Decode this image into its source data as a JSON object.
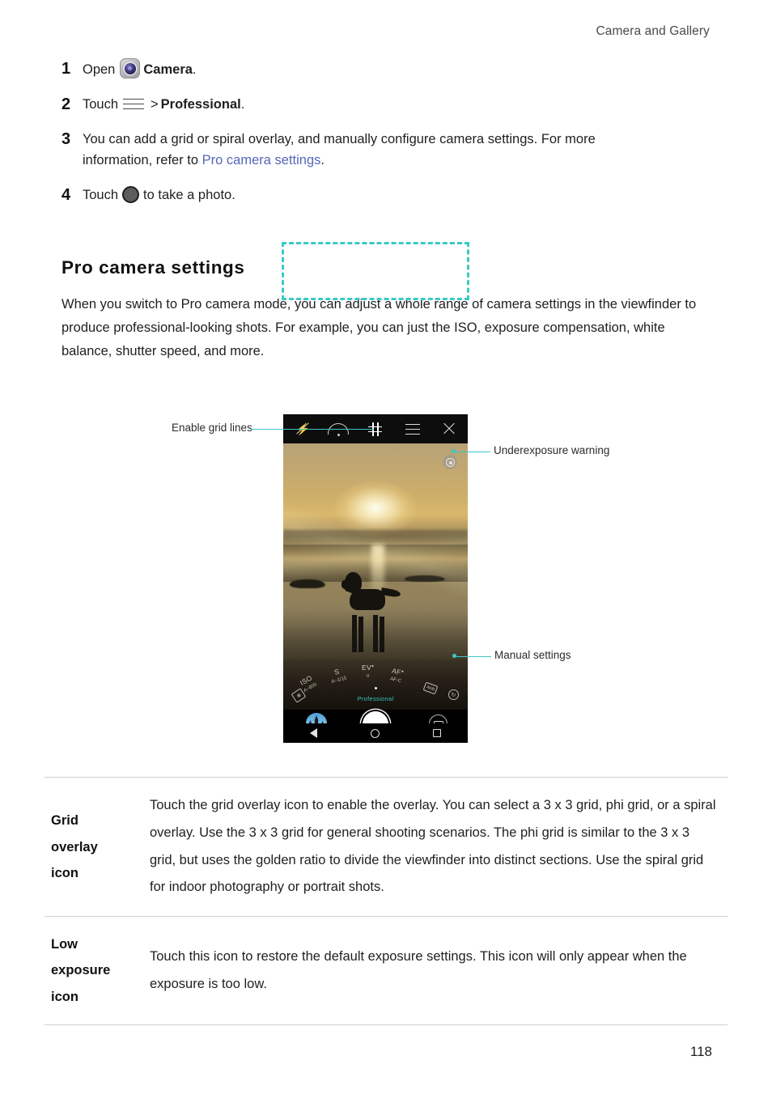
{
  "header": {
    "running_head": "Camera and Gallery"
  },
  "steps": [
    {
      "num": "1",
      "pre": "Open",
      "icon": "camera-app-icon",
      "bold": "Camera",
      "post": "."
    },
    {
      "num": "2",
      "pre": "Touch",
      "icon": "hamburger-menu-icon",
      "sep": ">",
      "bold": "Professional",
      "post": "."
    },
    {
      "num": "3",
      "line1": "You can add a grid or spiral overlay, and manually configure camera settings. For more",
      "line2_pre": "information, refer to ",
      "link": "Pro camera settings",
      "line2_post": "."
    },
    {
      "num": "4",
      "pre": "Touch",
      "icon": "shutter-button-icon",
      "post": "to take a photo."
    }
  ],
  "section": {
    "heading": "Pro camera settings",
    "paragraph": "When you switch to Pro camera mode, you can adjust a whole range of camera settings in the viewfinder to produce professional-looking shots. For example, you can just the ISO, exposure compensation, white balance, shutter speed, and more."
  },
  "figure": {
    "callouts": [
      {
        "id": "enable-grid-lines",
        "label": "Enable grid lines"
      },
      {
        "id": "underexposure-warning",
        "label": "Underexposure warning"
      },
      {
        "id": "manual-settings",
        "label": "Manual settings"
      }
    ],
    "accent_color": "#3cc9c4",
    "phone_screen": {
      "top_bar_icons": [
        "flash-off-icon",
        "arc-icon",
        "grid-overlay-icon",
        "hamburger-menu-icon",
        "close-icon"
      ],
      "manual_dial": {
        "iso_label": "ISO",
        "iso_value": "A~800",
        "shutter_label": "S",
        "shutter_value": "A~1/15",
        "ev_label": "EV",
        "ev_value": "0",
        "af_label": "AF",
        "af_value": "AF-C",
        "wb_left_icon": "metering-icon",
        "wb_right_label": "AWB",
        "meter_icon": "timer-icon",
        "mode_label": "Professional",
        "mode_color": "#36c6c0"
      },
      "bottom_bar_icons": [
        "gallery-thumbnail",
        "shutter-button",
        "video-mode-icon"
      ],
      "nav_bar_icons": [
        "back-icon",
        "home-icon",
        "recents-icon"
      ]
    }
  },
  "table": {
    "rows": [
      {
        "term": [
          "Grid",
          "overlay",
          "icon"
        ],
        "definition": "Touch the grid overlay icon to enable the overlay. You can select a 3 x 3 grid, phi grid, or a spiral overlay. Use the 3 x 3 grid for general shooting scenarios. The phi grid is similar to the 3 x 3 grid, but uses the golden ratio to divide the viewfinder into distinct sections. Use the spiral grid for indoor photography or portrait shots."
      },
      {
        "term": [
          "Low",
          "exposure",
          "icon"
        ],
        "definition": "Touch this icon to restore the default exposure settings. This icon will only appear when the exposure is too low."
      }
    ]
  },
  "footer": {
    "page_number": "118"
  }
}
